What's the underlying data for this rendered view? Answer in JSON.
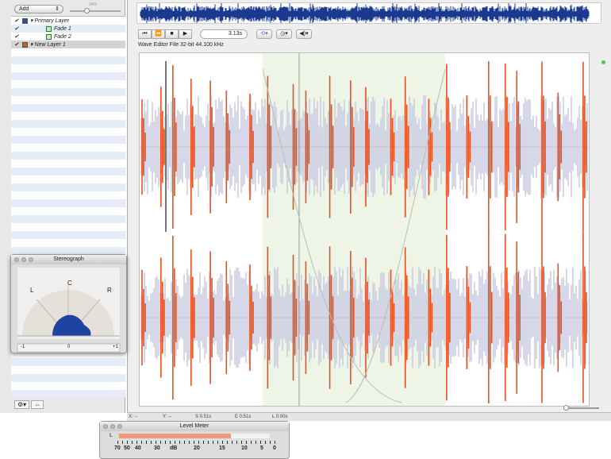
{
  "layers_panel": {
    "add_label": "Add",
    "opacity": "34%",
    "layers": [
      {
        "name": "Primary Layer",
        "color": "#2a4fa8",
        "indent": 0,
        "group": true
      },
      {
        "name": "Fade 1",
        "indent": 1
      },
      {
        "name": "Fade 2",
        "indent": 1
      },
      {
        "name": "New Layer 1",
        "color": "#e0502a",
        "indent": 0,
        "group": true
      }
    ]
  },
  "transport": {
    "time": "3.13s",
    "buttons": [
      "⏮",
      "⏪",
      "■",
      "▶"
    ]
  },
  "info": "Wave Editor File   32-bit   44.100 kHz",
  "status": {
    "x": "X: --",
    "y": "Y: --",
    "start": "S 0.51s",
    "end": "E 0.51s",
    "length": "L 0.00s"
  },
  "stereograph": {
    "title": "Stereograph",
    "left": "L",
    "center": "C",
    "right": "R",
    "scale": [
      "-1",
      "0",
      "+1"
    ]
  },
  "level_meter": {
    "title": "Level Meter",
    "channel": "L",
    "ticks": [
      "70",
      "50",
      "40",
      "30",
      "dB",
      "20",
      "15",
      "10",
      "5",
      "0"
    ],
    "level": 0.74
  },
  "colors": {
    "wave": "#e8501e",
    "noise": "#c9cbe2",
    "overview": "#1a3a8f",
    "selection": "#eef4e6"
  }
}
